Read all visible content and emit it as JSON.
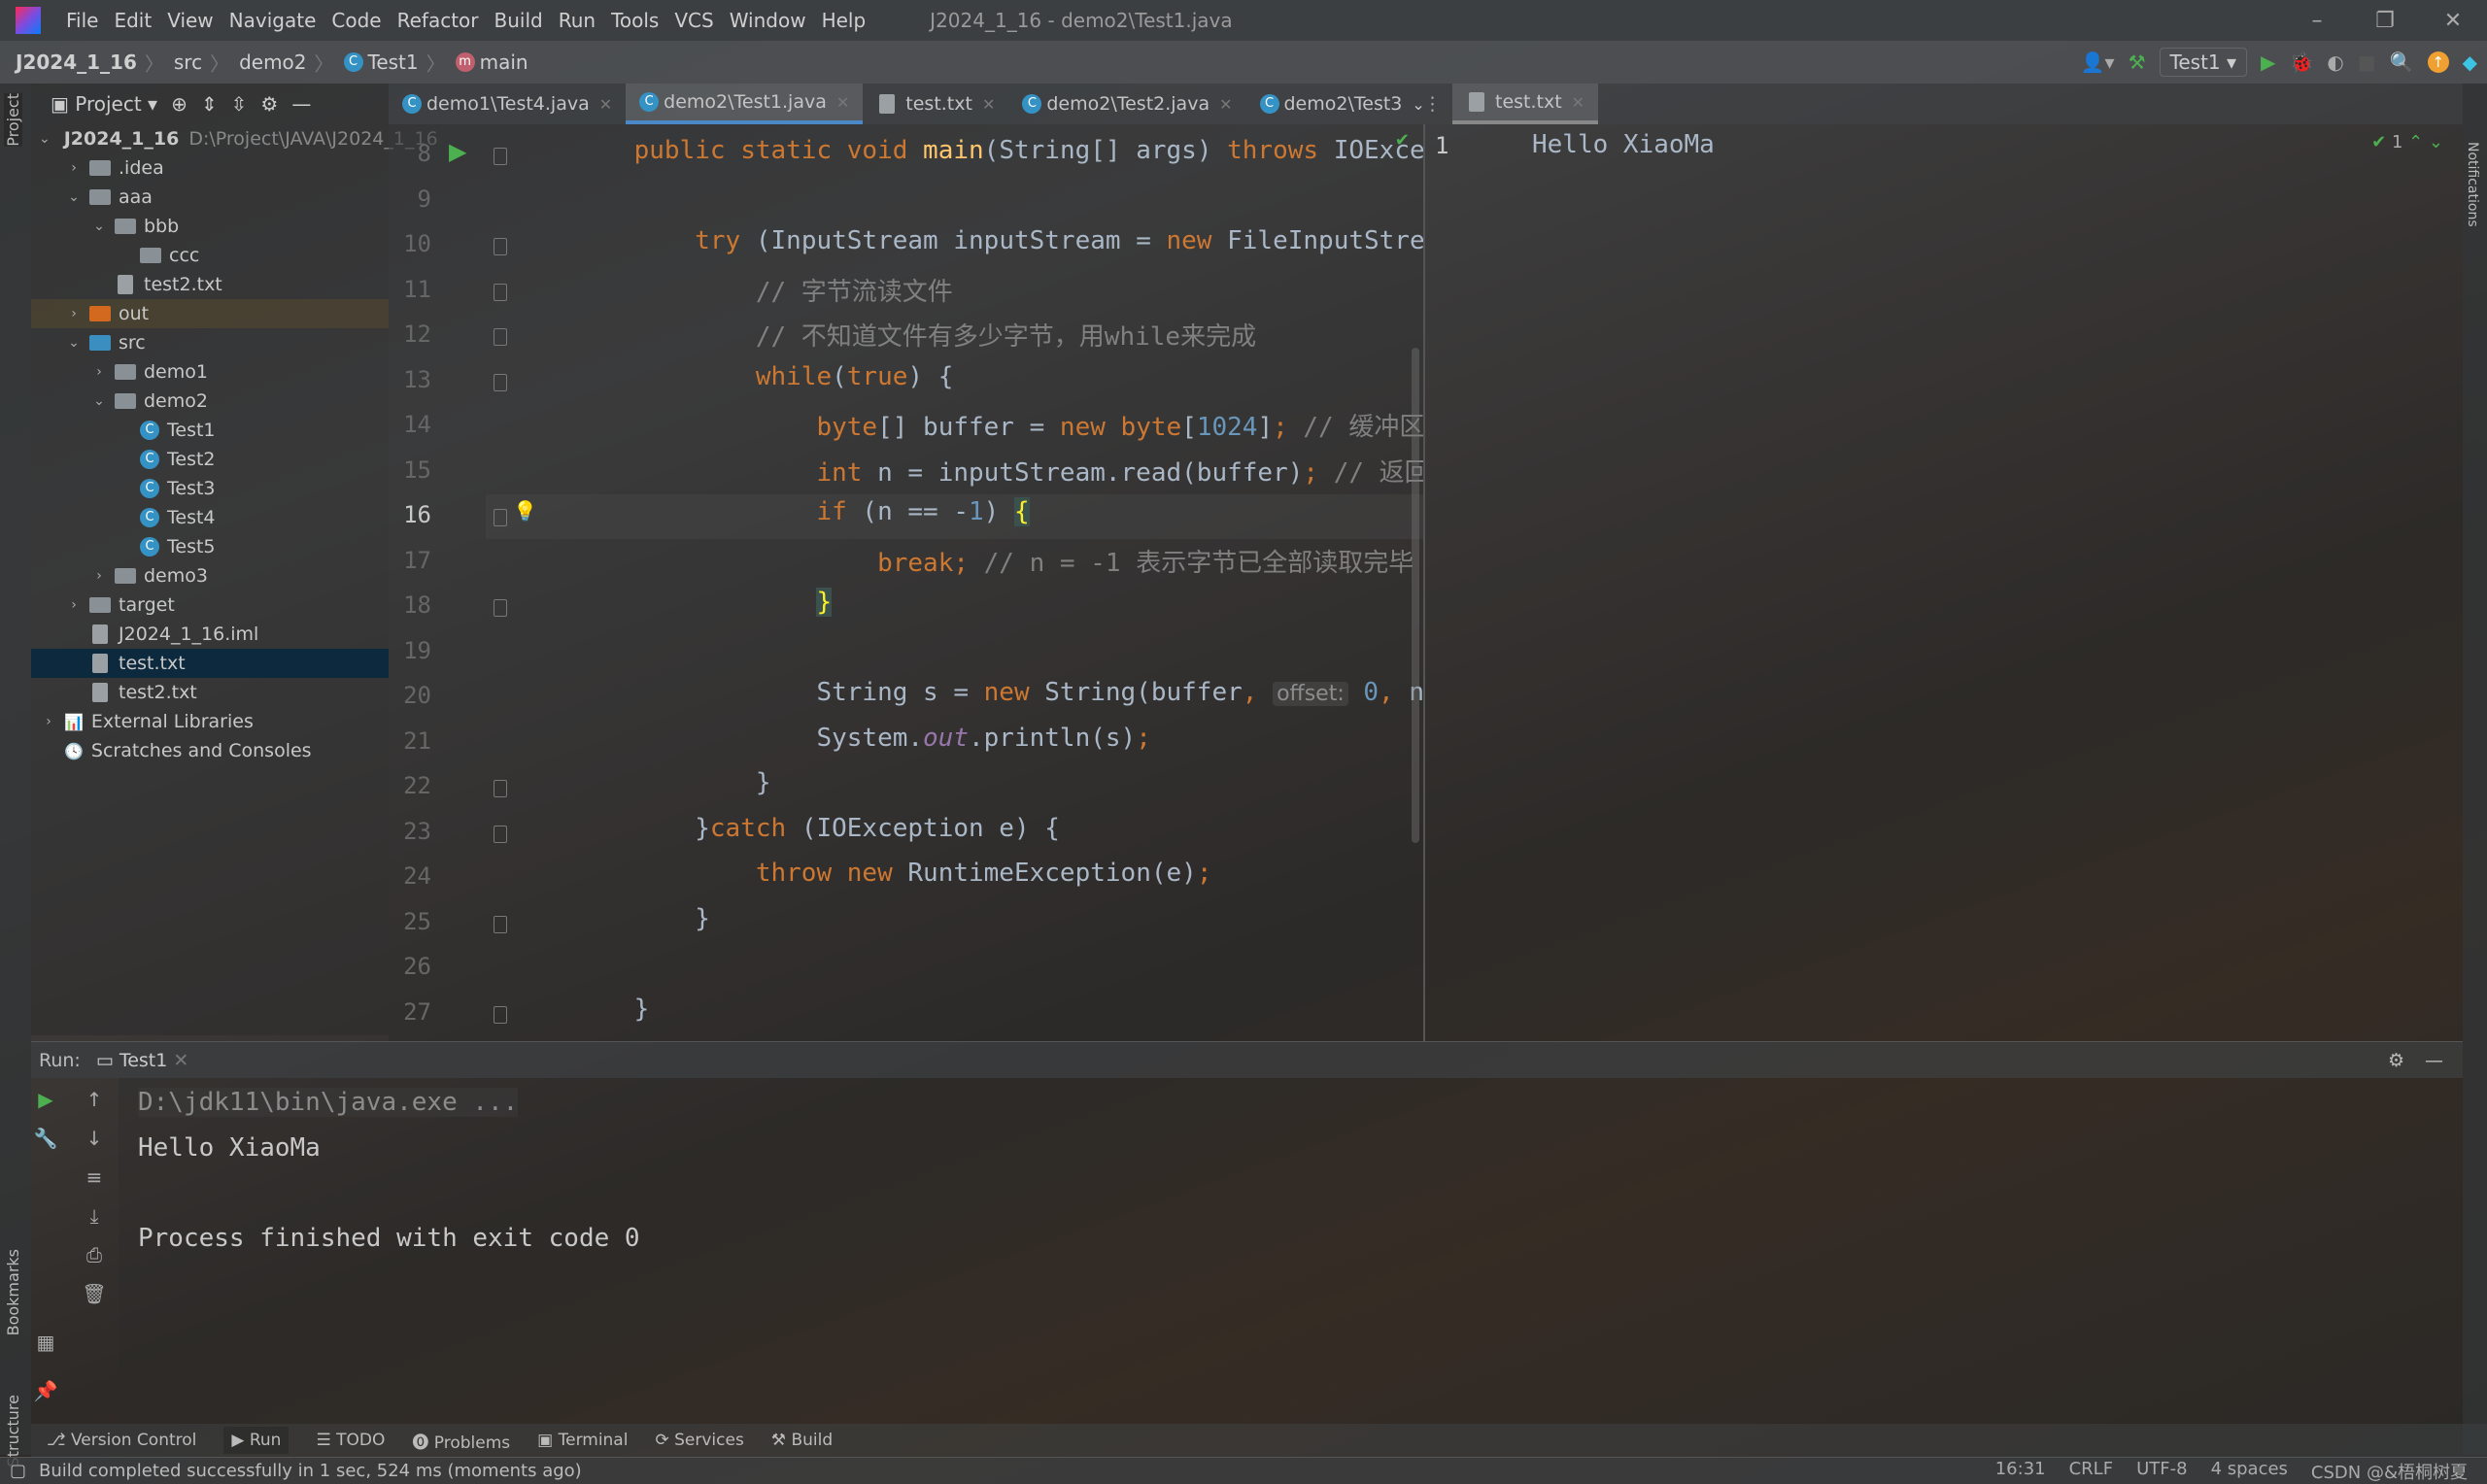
{
  "window": {
    "title": "J2024_1_16 - demo2\\Test1.java",
    "logo": "IJ"
  },
  "menu": [
    "File",
    "Edit",
    "View",
    "Navigate",
    "Code",
    "Refactor",
    "Build",
    "Run",
    "Tools",
    "VCS",
    "Window",
    "Help"
  ],
  "breadcrumb": {
    "project": "J2024_1_16",
    "items": [
      "src",
      "demo2"
    ],
    "class": "Test1",
    "method": "main"
  },
  "toolbar": {
    "run_config": "Test1"
  },
  "project_panel": {
    "title": "Project",
    "tree": [
      {
        "label": "J2024_1_16",
        "path": "D:\\Project\\JAVA\\J2024_1_16",
        "depth": 0,
        "arrow": "v",
        "icon": "module",
        "bold": true
      },
      {
        "label": ".idea",
        "depth": 1,
        "arrow": ">",
        "icon": "folder"
      },
      {
        "label": "aaa",
        "depth": 1,
        "arrow": "v",
        "icon": "folder"
      },
      {
        "label": "bbb",
        "depth": 2,
        "arrow": "v",
        "icon": "folder"
      },
      {
        "label": "ccc",
        "depth": 3,
        "arrow": "",
        "icon": "folder"
      },
      {
        "label": "test2.txt",
        "depth": 2,
        "arrow": "",
        "icon": "file"
      },
      {
        "label": "out",
        "depth": 1,
        "arrow": ">",
        "icon": "folder-orange"
      },
      {
        "label": "src",
        "depth": 1,
        "arrow": "v",
        "icon": "folder-blue"
      },
      {
        "label": "demo1",
        "depth": 2,
        "arrow": ">",
        "icon": "package"
      },
      {
        "label": "demo2",
        "depth": 2,
        "arrow": "v",
        "icon": "package"
      },
      {
        "label": "Test1",
        "depth": 3,
        "arrow": "",
        "icon": "class"
      },
      {
        "label": "Test2",
        "depth": 3,
        "arrow": "",
        "icon": "class"
      },
      {
        "label": "Test3",
        "depth": 3,
        "arrow": "",
        "icon": "class"
      },
      {
        "label": "Test4",
        "depth": 3,
        "arrow": "",
        "icon": "class"
      },
      {
        "label": "Test5",
        "depth": 3,
        "arrow": "",
        "icon": "class"
      },
      {
        "label": "demo3",
        "depth": 2,
        "arrow": ">",
        "icon": "package"
      },
      {
        "label": "target",
        "depth": 1,
        "arrow": ">",
        "icon": "folder"
      },
      {
        "label": "J2024_1_16.iml",
        "depth": 1,
        "arrow": "",
        "icon": "file"
      },
      {
        "label": "test.txt",
        "depth": 1,
        "arrow": "",
        "icon": "file",
        "selected": true
      },
      {
        "label": "test2.txt",
        "depth": 1,
        "arrow": "",
        "icon": "file"
      },
      {
        "label": "External Libraries",
        "depth": 0,
        "arrow": ">",
        "icon": "library"
      },
      {
        "label": "Scratches and Consoles",
        "depth": 0,
        "arrow": "",
        "icon": "scratch"
      }
    ]
  },
  "tabs": [
    {
      "label": "demo1\\Test4.java",
      "icon": "class"
    },
    {
      "label": "demo2\\Test1.java",
      "icon": "class",
      "active": true
    },
    {
      "label": "test.txt",
      "icon": "file"
    },
    {
      "label": "demo2\\Test2.java",
      "icon": "class"
    },
    {
      "label": "demo2\\Test3",
      "icon": "class"
    }
  ],
  "right_tab": {
    "label": "test.txt"
  },
  "editor": {
    "current_line": 16,
    "lines": [
      {
        "n": 8,
        "t": [
          [
            "    "
          ],
          [
            "public static void ",
            "kw"
          ],
          [
            "main",
            "fn"
          ],
          [
            "(String[] args) "
          ],
          [
            "throws ",
            "kw"
          ],
          [
            "IOExcepti"
          ]
        ]
      },
      {
        "n": 9,
        "t": []
      },
      {
        "n": 10,
        "t": [
          [
            "        "
          ],
          [
            "try ",
            "kw"
          ],
          [
            "(InputStream inputStream = "
          ],
          [
            "new ",
            "kw"
          ],
          [
            "FileInputStream("
          ]
        ]
      },
      {
        "n": 11,
        "t": [
          [
            "            "
          ],
          [
            "// 字节流读文件",
            "cm"
          ]
        ]
      },
      {
        "n": 12,
        "t": [
          [
            "            "
          ],
          [
            "// 不知道文件有多少字节，用while来完成",
            "cm"
          ]
        ]
      },
      {
        "n": 13,
        "t": [
          [
            "            "
          ],
          [
            "while",
            "kw"
          ],
          [
            "("
          ],
          [
            "true",
            "kw"
          ],
          [
            ") {"
          ]
        ]
      },
      {
        "n": 14,
        "t": [
          [
            "                "
          ],
          [
            "byte",
            "kw"
          ],
          [
            "[] buffer = "
          ],
          [
            "new byte",
            "kw"
          ],
          [
            "["
          ],
          [
            "1024",
            "num"
          ],
          [
            "]"
          ],
          [
            "; ",
            "kw"
          ],
          [
            "// 缓冲区",
            "cm"
          ]
        ]
      },
      {
        "n": 15,
        "t": [
          [
            "                "
          ],
          [
            "int ",
            "kw"
          ],
          [
            "n = inputStream.read(buffer)"
          ],
          [
            "; ",
            "kw"
          ],
          [
            "// 返回值",
            "cm"
          ]
        ]
      },
      {
        "n": 16,
        "t": [
          [
            "                "
          ],
          [
            "if ",
            "kw"
          ],
          [
            "(n == -"
          ],
          [
            "1",
            "num"
          ],
          [
            ") "
          ],
          [
            "{",
            "brace"
          ]
        ]
      },
      {
        "n": 17,
        "t": [
          [
            "                    "
          ],
          [
            "break; ",
            "kw"
          ],
          [
            "// n = -1 表示字节已全部读取完毕",
            "cm"
          ]
        ]
      },
      {
        "n": 18,
        "t": [
          [
            "                "
          ],
          [
            "}",
            "brace"
          ]
        ]
      },
      {
        "n": 19,
        "t": []
      },
      {
        "n": 20,
        "t": [
          [
            "                String s = "
          ],
          [
            "new ",
            "kw"
          ],
          [
            "String(buffer"
          ],
          [
            ", ",
            "kw"
          ],
          [
            "offset:",
            "hint"
          ],
          [
            " "
          ],
          [
            "0",
            "num"
          ],
          [
            ", ",
            "kw"
          ],
          [
            "n)"
          ],
          [
            ";",
            "kw"
          ]
        ]
      },
      {
        "n": 21,
        "t": [
          [
            "                System."
          ],
          [
            "out",
            "fld"
          ],
          [
            ".println(s)"
          ],
          [
            ";",
            "kw"
          ]
        ]
      },
      {
        "n": 22,
        "t": [
          [
            "            }"
          ]
        ]
      },
      {
        "n": 23,
        "t": [
          [
            "        }"
          ],
          [
            "catch ",
            "kw"
          ],
          [
            "(IOException e) {"
          ]
        ]
      },
      {
        "n": 24,
        "t": [
          [
            "            "
          ],
          [
            "throw new ",
            "kw"
          ],
          [
            "RuntimeException(e)"
          ],
          [
            ";",
            "kw"
          ]
        ]
      },
      {
        "n": 25,
        "t": [
          [
            "        }"
          ]
        ]
      },
      {
        "n": 26,
        "t": []
      },
      {
        "n": 27,
        "t": [
          [
            "    }"
          ]
        ]
      }
    ]
  },
  "text_editor": {
    "line": "1",
    "content": "Hello XiaoMa",
    "inspections": "1"
  },
  "run": {
    "label": "Run:",
    "tab": "Test1",
    "console": [
      "D:\\jdk11\\bin\\java.exe ...",
      "Hello XiaoMa",
      "",
      "Process finished with exit code 0"
    ]
  },
  "tool_windows": [
    "Version Control",
    "Run",
    "TODO",
    "Problems",
    "Terminal",
    "Services",
    "Build"
  ],
  "side_labels": {
    "project": "Project",
    "bookmarks": "Bookmarks",
    "structure": "Structure",
    "notifications": "Notifications"
  },
  "status": {
    "message": "Build completed successfully in 1 sec, 524 ms (moments ago)",
    "position": "16:31",
    "line_sep": "CRLF",
    "encoding": "UTF-8",
    "indent": "4 spaces",
    "watermark": "CSDN @&梧桐树夏"
  },
  "colors": {
    "keyword": "#cc7832",
    "method": "#ffc66d",
    "comment": "#808080",
    "number": "#6897bb",
    "accent": "#4a88c7"
  }
}
